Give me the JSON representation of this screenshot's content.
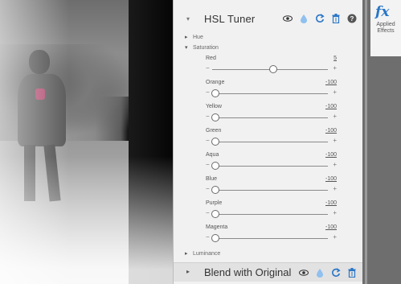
{
  "panel": {
    "title": "HSL Tuner",
    "sections": {
      "hue": "Hue",
      "saturation": "Saturation",
      "luminance": "Luminance"
    },
    "sliders": [
      {
        "name": "Red",
        "value": "5",
        "level": 0.53
      },
      {
        "name": "Orange",
        "value": "-100",
        "level": 0.0
      },
      {
        "name": "Yellow",
        "value": "-100",
        "level": 0.0
      },
      {
        "name": "Green",
        "value": "-100",
        "level": 0.0
      },
      {
        "name": "Aqua",
        "value": "-100",
        "level": 0.0
      },
      {
        "name": "Blue",
        "value": "-100",
        "level": 0.0
      },
      {
        "name": "Purple",
        "value": "-100",
        "level": 0.0
      },
      {
        "name": "Magenta",
        "value": "-100",
        "level": 0.0
      }
    ],
    "minus_glyph": "−",
    "plus_glyph": "+"
  },
  "blend": {
    "title": "Blend with Original"
  },
  "sidebar": {
    "fx_glyph": "fx",
    "label_line1": "Applied",
    "label_line2": "Effects"
  },
  "icons": [
    "eye-icon",
    "drop-icon",
    "reset-icon",
    "trash-icon",
    "help-icon",
    "fx-icon"
  ],
  "colors": {
    "accent": "#2a76c6",
    "drop": "#5aa0e6",
    "panel": "#f1f1f1",
    "sidebar": "#6e6e6e"
  }
}
